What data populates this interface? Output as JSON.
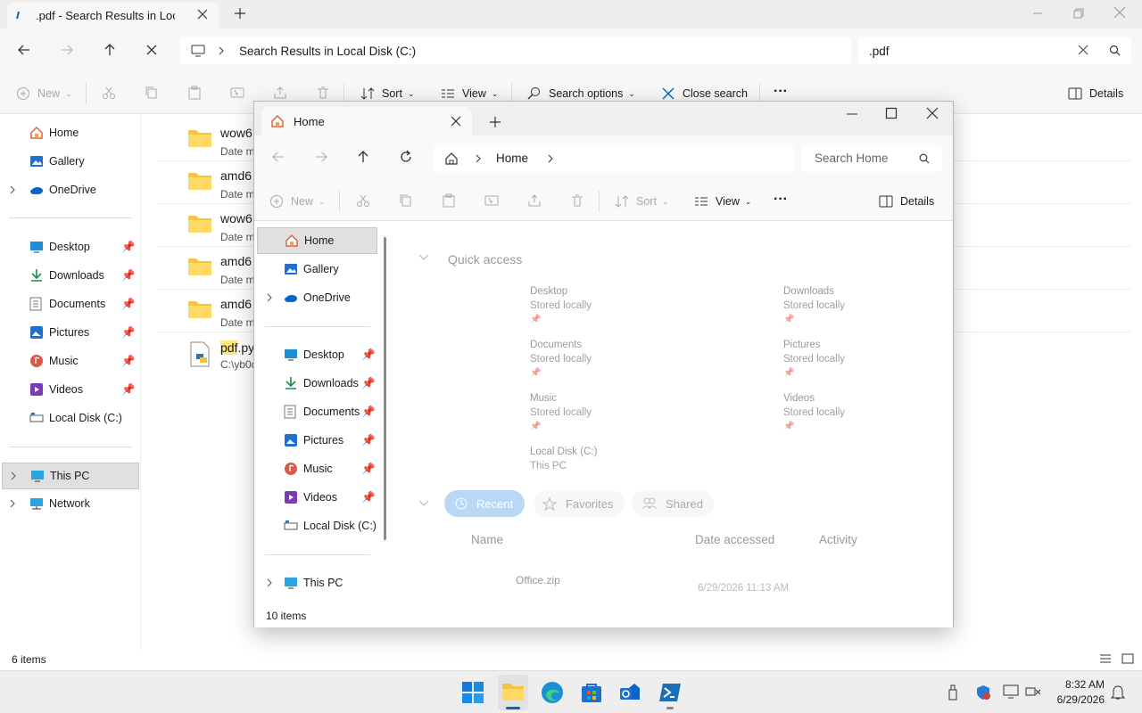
{
  "back": {
    "tab_title": ".pdf - Search Results in Local Disk (C:)",
    "address": "Search Results in Local Disk (C:)",
    "search_value": ".pdf",
    "cmd": {
      "new": "New",
      "sort": "Sort",
      "view": "View",
      "search_options": "Search options",
      "close_search": "Close search",
      "details": "Details"
    },
    "sidebar": [
      {
        "label": "Home",
        "icon": "home-icon"
      },
      {
        "label": "Gallery",
        "icon": "gallery-icon"
      },
      {
        "label": "OneDrive",
        "icon": "cloud-icon"
      },
      {
        "label": "Desktop",
        "icon": "desktop-icon"
      },
      {
        "label": "Downloads",
        "icon": "download-icon"
      },
      {
        "label": "Documents",
        "icon": "document-icon"
      },
      {
        "label": "Pictures",
        "icon": "pictures-icon"
      },
      {
        "label": "Music",
        "icon": "music-icon"
      },
      {
        "label": "Videos",
        "icon": "videos-icon"
      },
      {
        "label": "Local Disk (C:)",
        "icon": "drive-icon"
      },
      {
        "label": "This PC",
        "icon": "pc-icon"
      },
      {
        "label": "Network",
        "icon": "network-icon"
      }
    ],
    "results": [
      {
        "name": "wow6",
        "sub": "Date m"
      },
      {
        "name": "amd6",
        "sub": "Date m"
      },
      {
        "name": "wow6",
        "sub": "Date m"
      },
      {
        "name": "amd6",
        "sub": "Date m"
      },
      {
        "name": "amd6",
        "sub": "Date m"
      },
      {
        "name_hl": "pdf",
        "name_rest": ".py",
        "sub": "C:\\yb0d"
      }
    ],
    "status": "6 items"
  },
  "front": {
    "tab_title": "Home",
    "breadcrumb": "Home",
    "search_placeholder": "Search Home",
    "cmd": {
      "new": "New",
      "sort": "Sort",
      "view": "View",
      "details": "Details"
    },
    "sidebar": [
      {
        "label": "Home",
        "icon": "home-icon"
      },
      {
        "label": "Gallery",
        "icon": "gallery-icon"
      },
      {
        "label": "OneDrive",
        "icon": "cloud-icon"
      },
      {
        "label": "Desktop",
        "icon": "desktop-icon"
      },
      {
        "label": "Downloads",
        "icon": "download-icon"
      },
      {
        "label": "Documents",
        "icon": "document-icon"
      },
      {
        "label": "Pictures",
        "icon": "pictures-icon"
      },
      {
        "label": "Music",
        "icon": "music-icon"
      },
      {
        "label": "Videos",
        "icon": "videos-icon"
      },
      {
        "label": "Local Disk (C:)",
        "icon": "drive-icon"
      },
      {
        "label": "This PC",
        "icon": "pc-icon"
      }
    ],
    "quick_access_title": "Quick access",
    "quick_access": [
      {
        "name": "Desktop",
        "sub": "Stored locally"
      },
      {
        "name": "Downloads",
        "sub": "Stored locally"
      },
      {
        "name": "Documents",
        "sub": "Stored locally"
      },
      {
        "name": "Pictures",
        "sub": "Stored locally"
      },
      {
        "name": "Music",
        "sub": "Stored locally"
      },
      {
        "name": "Videos",
        "sub": "Stored locally"
      },
      {
        "name": "Local Disk (C:)",
        "sub": "This PC"
      }
    ],
    "tabs": {
      "recent": "Recent",
      "favorites": "Favorites",
      "shared": "Shared"
    },
    "columns": {
      "name": "Name",
      "date": "Date accessed",
      "activity": "Activity"
    },
    "recent_file": {
      "name": "Office.zip",
      "date": "6/29/2026 11:13 AM"
    },
    "status": "10 items"
  },
  "taskbar": {
    "apps": [
      "start-icon",
      "file-explorer-icon",
      "edge-icon",
      "store-icon",
      "outlook-icon",
      "powershell-icon"
    ],
    "time": "8:32 AM",
    "date": "6/29/2026"
  },
  "colors": {
    "accent": "#0067c0",
    "folder": "#f4c542",
    "selected": "#e0e0e0"
  }
}
